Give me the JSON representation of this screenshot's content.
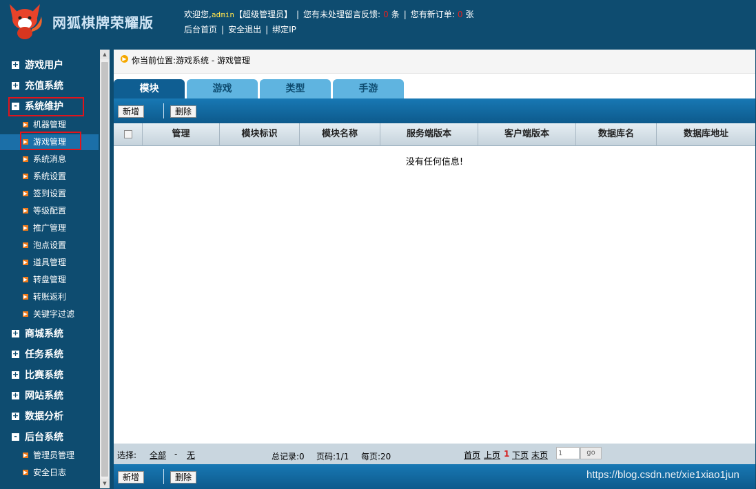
{
  "header": {
    "title": "网狐棋牌荣耀版",
    "welcome_prefix": "欢迎您,",
    "username": "admin",
    "role": "【超级管理员】",
    "feedback_prefix": "您有未处理留言反馈:",
    "feedback_count": "0",
    "feedback_unit": "条",
    "orders_prefix": "您有新订单:",
    "orders_count": "0",
    "orders_unit": "张",
    "separator": "|",
    "nav": {
      "home": "后台首页",
      "logout": "安全退出",
      "bind_ip": "绑定IP"
    }
  },
  "sidebar": {
    "groups": [
      {
        "label": "游戏用户",
        "state": "+"
      },
      {
        "label": "充值系统",
        "state": "+"
      },
      {
        "label": "系统维护",
        "state": "-"
      },
      {
        "label": "商城系统",
        "state": "+"
      },
      {
        "label": "任务系统",
        "state": "+"
      },
      {
        "label": "比赛系统",
        "state": "+"
      },
      {
        "label": "网站系统",
        "state": "+"
      },
      {
        "label": "数据分析",
        "state": "+"
      },
      {
        "label": "后台系统",
        "state": "-"
      }
    ],
    "maintenance_items": [
      "机器管理",
      "游戏管理",
      "系统消息",
      "系统设置",
      "签到设置",
      "等级配置",
      "推广管理",
      "泡点设置",
      "道具管理",
      "转盘管理",
      "转账返利",
      "关键字过滤"
    ],
    "backend_items": [
      "管理员管理",
      "安全日志"
    ],
    "active_item": "游戏管理"
  },
  "breadcrumb": {
    "text": "你当前位置:游戏系统 - 游戏管理"
  },
  "tabs": [
    "模块",
    "游戏",
    "类型",
    "手游"
  ],
  "active_tab": "模块",
  "toolbar": {
    "add": "新增",
    "delete": "删除"
  },
  "table": {
    "columns": [
      "管理",
      "模块标识",
      "模块名称",
      "服务端版本",
      "客户端版本",
      "数据库名",
      "数据库地址"
    ],
    "empty_message": "没有任何信息!"
  },
  "footer": {
    "select_label": "选择:",
    "select_all": "全部",
    "select_dash": "-",
    "select_none": "无",
    "total": "总记录:0",
    "pages": "页码:1/1",
    "per_page": "每页:20",
    "first": "首页",
    "prev": "上页",
    "current": "1",
    "next": "下页",
    "last": "末页",
    "page_input": "1",
    "go": "go"
  },
  "watermark": "https://blog.csdn.net/xie1xiao1jun",
  "colors": {
    "background": "#0e4c70",
    "tab_active": "#0f5e92",
    "tab_inactive": "#5fb4e0",
    "highlight_box": "#e0141c",
    "sidebar_arrow": "#f07a1a"
  }
}
